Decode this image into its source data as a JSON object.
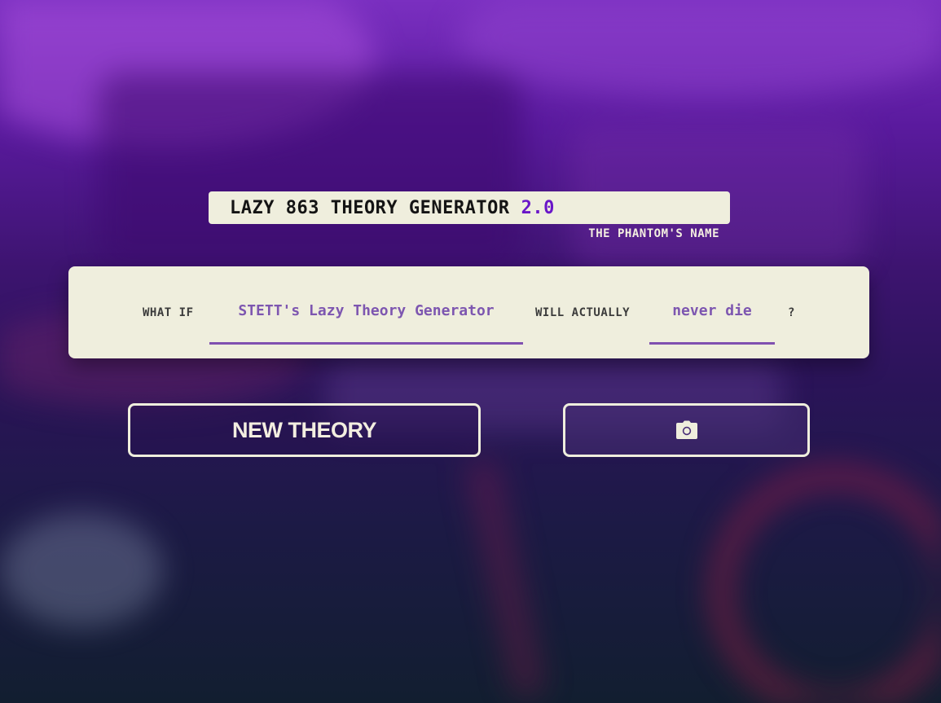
{
  "header": {
    "title": "LAZY 863 THEORY GENERATOR",
    "version": "2.0",
    "subtitle": "THE PHANTOM'S NAME"
  },
  "theory": {
    "what_if_label": "WHAT IF",
    "subject": "STETT's Lazy Theory Generator",
    "will_actually_label": "WILL ACTUALLY",
    "fate": "never die",
    "question_mark": "?"
  },
  "actions": {
    "new_theory_label": "NEW THEORY",
    "screenshot_icon": "camera-icon"
  },
  "colors": {
    "accent": "#6a16c8",
    "field_text": "#7d56b0",
    "card_bg": "#efeedd"
  }
}
